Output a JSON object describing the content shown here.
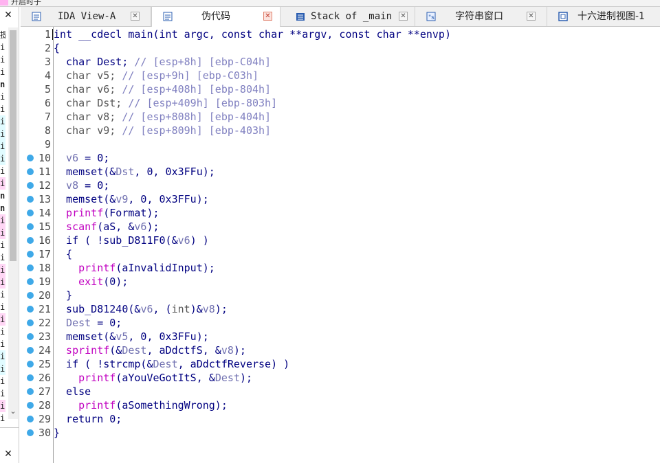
{
  "window": {
    "top_text": "开启时子"
  },
  "left_pane": {
    "close_glyph": "✕",
    "rows": [
      {
        "ch": "提",
        "style": "plain"
      },
      {
        "ch": "i",
        "style": "plain"
      },
      {
        "ch": "i",
        "style": "plain"
      },
      {
        "ch": "i",
        "style": "plain"
      },
      {
        "ch": "n",
        "style": "bold"
      },
      {
        "ch": "i",
        "style": "plain"
      },
      {
        "ch": "i",
        "style": "plain"
      },
      {
        "ch": "i",
        "style": "cyan"
      },
      {
        "ch": "i",
        "style": "cyan"
      },
      {
        "ch": "i",
        "style": "cyan"
      },
      {
        "ch": "i",
        "style": "cyan"
      },
      {
        "ch": "i",
        "style": "plain"
      },
      {
        "ch": "i",
        "style": "pinkbg"
      },
      {
        "ch": "n",
        "style": "bold"
      },
      {
        "ch": "n",
        "style": "bold"
      },
      {
        "ch": "i",
        "style": "pinkbg"
      },
      {
        "ch": "i",
        "style": "pinkbg"
      },
      {
        "ch": "i",
        "style": "plain"
      },
      {
        "ch": "i",
        "style": "plain"
      },
      {
        "ch": "i",
        "style": "pinkbg"
      },
      {
        "ch": "i",
        "style": "pinkbg"
      },
      {
        "ch": "i",
        "style": "plain"
      },
      {
        "ch": "i",
        "style": "plain"
      },
      {
        "ch": "i",
        "style": "pinkbg"
      },
      {
        "ch": "i",
        "style": "plain"
      },
      {
        "ch": "i",
        "style": "plain"
      },
      {
        "ch": "i",
        "style": "cyan"
      },
      {
        "ch": "i",
        "style": "cyan"
      },
      {
        "ch": "i",
        "style": "plain"
      },
      {
        "ch": "i",
        "style": "plain"
      },
      {
        "ch": "i",
        "style": "pinkbg"
      },
      {
        "ch": "i",
        "style": "plain"
      }
    ],
    "scroll_down_glyph": "⌄"
  },
  "tabs": [
    {
      "label": "IDA View-A",
      "icon": "ida-view-icon",
      "active": false,
      "close": "✕"
    },
    {
      "label": "伪代码",
      "icon": "pseudocode-icon",
      "active": true,
      "close": "✕"
    },
    {
      "label": "Stack of _main",
      "icon": "stack-icon",
      "active": false,
      "close": "✕"
    },
    {
      "label": "字符串窗口",
      "icon": "strings-icon",
      "active": false,
      "close": "✕"
    },
    {
      "label": "十六进制视图-1",
      "icon": "hex-view-icon",
      "active": false,
      "close": "✕"
    }
  ],
  "code": {
    "lines": [
      {
        "n": "1",
        "dot": false,
        "parts": [
          [
            "kw",
            "int __cdecl main(int argc, const char **argv, const char **envp)"
          ]
        ]
      },
      {
        "n": "2",
        "dot": false,
        "parts": [
          [
            "kw",
            "{"
          ]
        ]
      },
      {
        "n": "3",
        "dot": false,
        "parts": [
          [
            "kw",
            "  char "
          ],
          [
            "kw",
            "Dest"
          ],
          [
            "kw",
            "; "
          ],
          [
            "cmt",
            "// [esp+8h] [ebp-C04h]"
          ]
        ]
      },
      {
        "n": "4",
        "dot": false,
        "parts": [
          [
            "gray",
            "  char v5; "
          ],
          [
            "cmt",
            "// [esp+9h] [ebp-C03h]"
          ]
        ]
      },
      {
        "n": "5",
        "dot": false,
        "parts": [
          [
            "gray",
            "  char v6; "
          ],
          [
            "cmt",
            "// [esp+408h] [ebp-804h]"
          ]
        ]
      },
      {
        "n": "6",
        "dot": false,
        "parts": [
          [
            "gray",
            "  char Dst; "
          ],
          [
            "cmt",
            "// [esp+409h] [ebp-803h]"
          ]
        ]
      },
      {
        "n": "7",
        "dot": false,
        "parts": [
          [
            "gray",
            "  char v8; "
          ],
          [
            "cmt",
            "// [esp+808h] [ebp-404h]"
          ]
        ]
      },
      {
        "n": "8",
        "dot": false,
        "parts": [
          [
            "gray",
            "  char v9; "
          ],
          [
            "cmt",
            "// [esp+809h] [ebp-403h]"
          ]
        ]
      },
      {
        "n": "9",
        "dot": false,
        "parts": [
          [
            "kw",
            ""
          ]
        ]
      },
      {
        "n": "10",
        "dot": true,
        "parts": [
          [
            "ivar",
            "  v6"
          ],
          [
            "kw",
            " = 0;"
          ]
        ]
      },
      {
        "n": "11",
        "dot": true,
        "parts": [
          [
            "kw",
            "  memset(&"
          ],
          [
            "ivar",
            "Dst"
          ],
          [
            "kw",
            ", 0, 0x3FFu);"
          ]
        ]
      },
      {
        "n": "12",
        "dot": true,
        "parts": [
          [
            "ivar",
            "  v8"
          ],
          [
            "kw",
            " = 0;"
          ]
        ]
      },
      {
        "n": "13",
        "dot": true,
        "parts": [
          [
            "kw",
            "  memset(&"
          ],
          [
            "ivar",
            "v9"
          ],
          [
            "kw",
            ", 0, 0x3FFu);"
          ]
        ]
      },
      {
        "n": "14",
        "dot": true,
        "parts": [
          [
            "pink",
            "  printf"
          ],
          [
            "kw",
            "(Format);"
          ]
        ]
      },
      {
        "n": "15",
        "dot": true,
        "parts": [
          [
            "pink",
            "  scanf"
          ],
          [
            "kw",
            "(aS, &"
          ],
          [
            "ivar",
            "v6"
          ],
          [
            "kw",
            ");"
          ]
        ]
      },
      {
        "n": "16",
        "dot": true,
        "parts": [
          [
            "kw",
            "  if ( !sub_D811F0(&"
          ],
          [
            "ivar",
            "v6"
          ],
          [
            "kw",
            ") )"
          ]
        ]
      },
      {
        "n": "17",
        "dot": true,
        "parts": [
          [
            "kw",
            "  {"
          ]
        ]
      },
      {
        "n": "18",
        "dot": true,
        "parts": [
          [
            "pink",
            "    printf"
          ],
          [
            "kw",
            "(aInvalidInput);"
          ]
        ]
      },
      {
        "n": "19",
        "dot": true,
        "parts": [
          [
            "pink",
            "    exit"
          ],
          [
            "kw",
            "(0);"
          ]
        ]
      },
      {
        "n": "20",
        "dot": true,
        "parts": [
          [
            "kw",
            "  }"
          ]
        ]
      },
      {
        "n": "21",
        "dot": true,
        "parts": [
          [
            "kw",
            "  sub_D81240(&"
          ],
          [
            "ivar",
            "v6"
          ],
          [
            "kw",
            ", ("
          ],
          [
            "gray",
            "int"
          ],
          [
            "kw",
            ")&"
          ],
          [
            "ivar",
            "v8"
          ],
          [
            "kw",
            ");"
          ]
        ]
      },
      {
        "n": "22",
        "dot": true,
        "parts": [
          [
            "ivar",
            "  Dest"
          ],
          [
            "kw",
            " = 0;"
          ]
        ]
      },
      {
        "n": "23",
        "dot": true,
        "parts": [
          [
            "kw",
            "  memset(&"
          ],
          [
            "ivar",
            "v5"
          ],
          [
            "kw",
            ", 0, 0x3FFu);"
          ]
        ]
      },
      {
        "n": "24",
        "dot": true,
        "parts": [
          [
            "pink",
            "  sprintf"
          ],
          [
            "kw",
            "(&"
          ],
          [
            "ivar",
            "Dest"
          ],
          [
            "kw",
            ", aDdctfS, &"
          ],
          [
            "ivar",
            "v8"
          ],
          [
            "kw",
            ");"
          ]
        ]
      },
      {
        "n": "25",
        "dot": true,
        "parts": [
          [
            "kw",
            "  if ( !strcmp(&"
          ],
          [
            "ivar",
            "Dest"
          ],
          [
            "kw",
            ", aDdctfReverse) )"
          ]
        ]
      },
      {
        "n": "26",
        "dot": true,
        "parts": [
          [
            "pink",
            "    printf"
          ],
          [
            "kw",
            "(aYouVeGotItS, &"
          ],
          [
            "ivar",
            "Dest"
          ],
          [
            "kw",
            ");"
          ]
        ]
      },
      {
        "n": "27",
        "dot": true,
        "parts": [
          [
            "kw",
            "  else"
          ]
        ]
      },
      {
        "n": "28",
        "dot": true,
        "parts": [
          [
            "pink",
            "    printf"
          ],
          [
            "kw",
            "(aSomethingWrong);"
          ]
        ]
      },
      {
        "n": "29",
        "dot": true,
        "parts": [
          [
            "kw",
            "  return 0;"
          ]
        ]
      },
      {
        "n": "30",
        "dot": true,
        "parts": [
          [
            "kw",
            "}"
          ]
        ]
      }
    ]
  },
  "colors": {
    "keyword": "#000080",
    "comment": "#8080c0",
    "function": "#c000c0",
    "local_var": "#7070b0",
    "breakpoint_dot": "#3fa9e8"
  }
}
